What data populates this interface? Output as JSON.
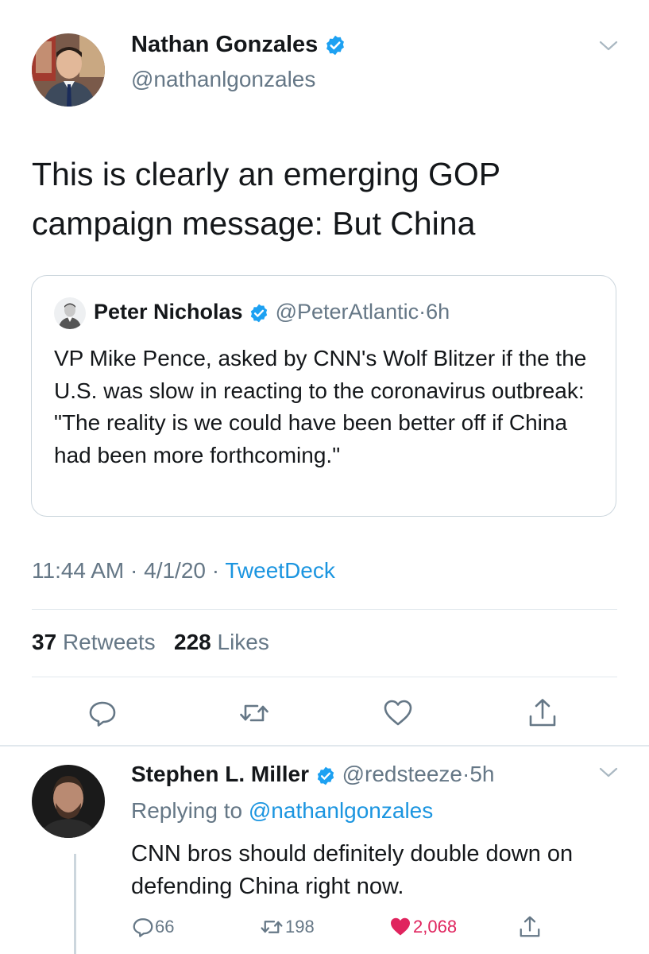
{
  "main_tweet": {
    "author_name": "Nathan Gonzales",
    "author_handle": "@nathanlgonzales",
    "text": "This is clearly an emerging GOP campaign message: But China",
    "time": "11:44 AM",
    "date": "4/1/20",
    "source": "TweetDeck",
    "separator": "·",
    "retweets_count": "37",
    "retweets_label": "Retweets",
    "likes_count": "228",
    "likes_label": "Likes"
  },
  "quoted_tweet": {
    "author_name": "Peter Nicholas",
    "author_handle": "@PeterAtlantic",
    "time_ago": "6h",
    "text": "VP Mike Pence, asked by CNN's Wolf Blitzer if the the U.S. was slow in reacting to the coronavirus outbreak: \"The reality is we could have been better off if China had been more forthcoming.\""
  },
  "reply": {
    "author_name": "Stephen L. Miller",
    "author_handle": "@redsteeze",
    "time_ago": "5h",
    "replying_prefix": "Replying to",
    "replying_to": "@nathanlgonzales",
    "text": "CNN bros should definitely double down on defending China right now.",
    "reply_count": "66",
    "retweet_count": "198",
    "like_count": "2,068"
  },
  "colors": {
    "link_blue": "#1b95e0",
    "verified_blue": "#1da1f2",
    "secondary_text": "#657786",
    "liked_red": "#e0245e",
    "divider": "#e1e8ed"
  },
  "icons": [
    "verified-badge-icon",
    "chevron-down-icon",
    "reply-icon",
    "retweet-icon",
    "like-icon",
    "share-icon"
  ]
}
